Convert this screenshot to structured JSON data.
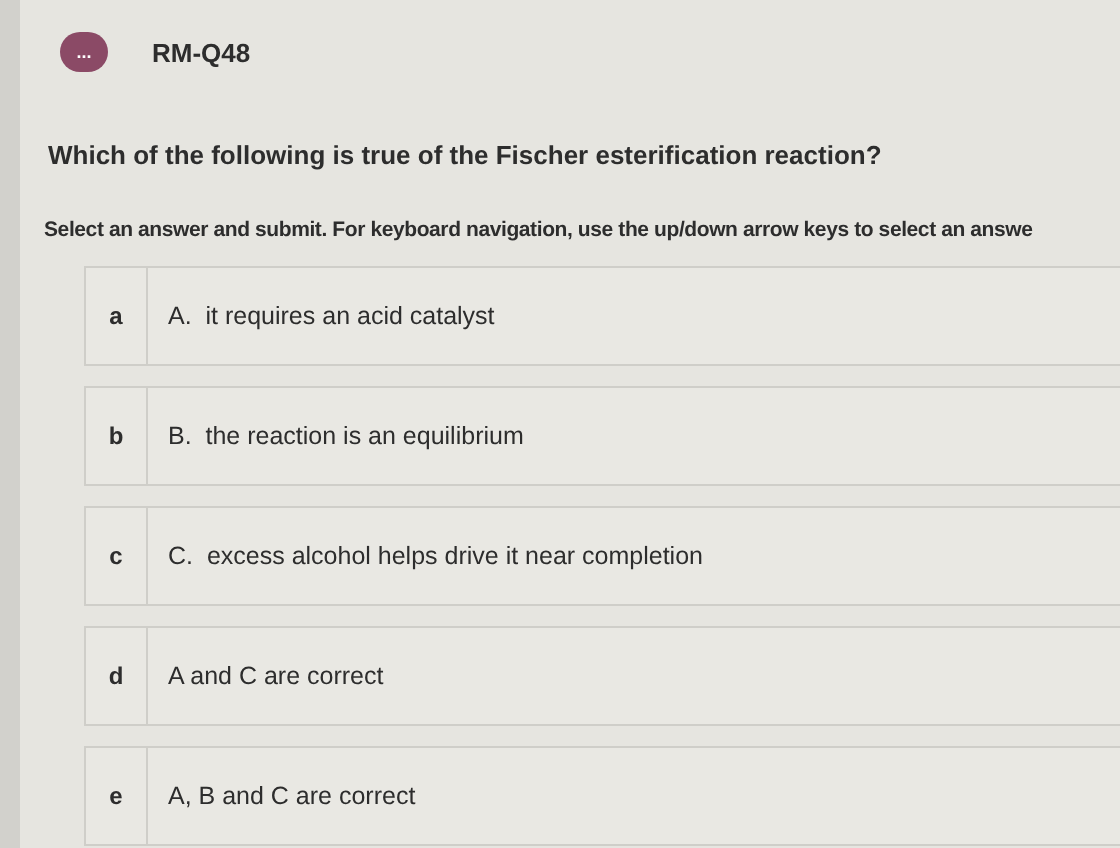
{
  "header": {
    "badge": "...",
    "title": "RM-Q48"
  },
  "question": "Which of the following is true of the Fischer esterification reaction?",
  "instructions": "Select an answer and submit. For keyboard navigation, use the up/down arrow keys to select an answe",
  "options": [
    {
      "key": "a",
      "text": "A.  it requires an acid catalyst"
    },
    {
      "key": "b",
      "text": "B.  the reaction is an equilibrium"
    },
    {
      "key": "c",
      "text": "C.  excess alcohol helps drive it near completion"
    },
    {
      "key": "d",
      "text": "A and C are correct"
    },
    {
      "key": "e",
      "text": "A, B and C are correct"
    }
  ]
}
